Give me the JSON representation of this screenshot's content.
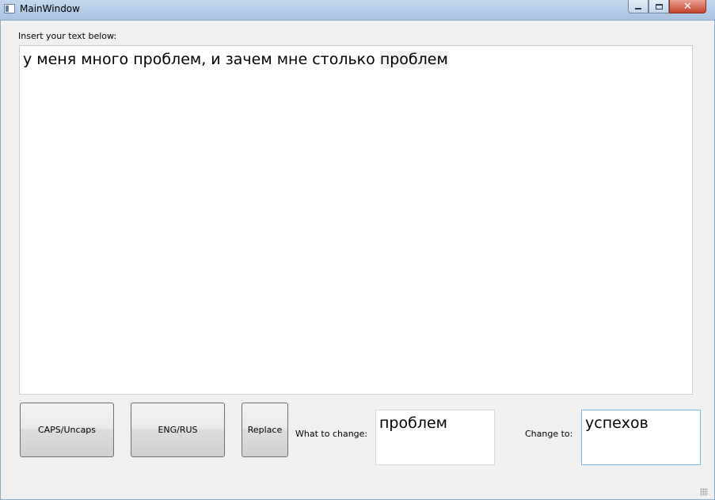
{
  "window": {
    "title": "MainWindow",
    "controls": {
      "minimize": "minimize",
      "maximize": "maximize",
      "close": "close"
    }
  },
  "editor": {
    "label": "Insert your text below:",
    "text_before": "у меня много проблем, и зачем мне столько ",
    "text_highlighted": "проблем"
  },
  "buttons": {
    "caps": "CAPS/Uncaps",
    "eng_rus": "ENG/RUS",
    "replace": "Replace"
  },
  "replace_fields": {
    "what_label": "What to change:",
    "what_value": "проблем",
    "to_label": "Change to:",
    "to_value": "успехов"
  },
  "colors": {
    "titlebar": "#a8c3e2",
    "close_button": "#c4432e",
    "focus_border": "#7eb4ea"
  }
}
